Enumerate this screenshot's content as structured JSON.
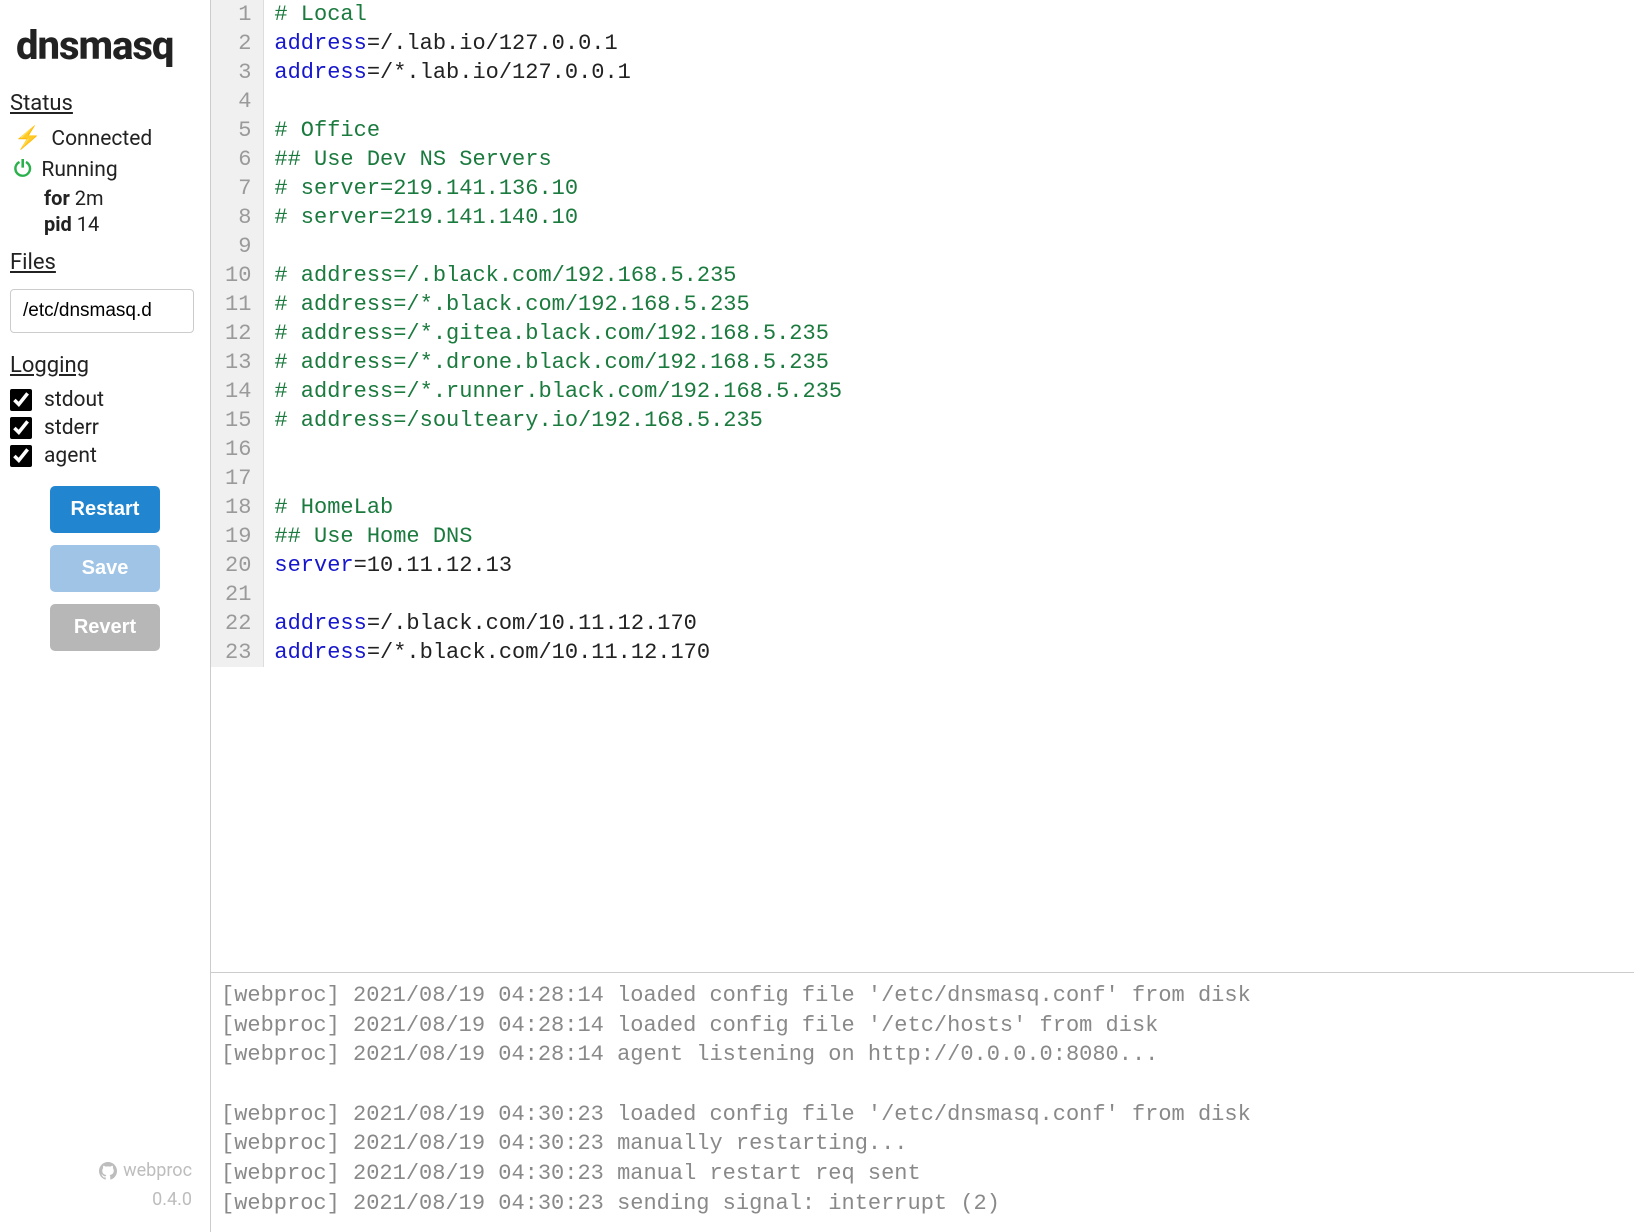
{
  "app": {
    "title": "dnsmasq"
  },
  "status": {
    "header": "Status",
    "connection": "Connected",
    "running": "Running",
    "uptime_label": "for",
    "uptime_value": "2m",
    "pid_label": "pid",
    "pid_value": "14"
  },
  "files": {
    "header": "Files",
    "selected": "/etc/dnsmasq.d"
  },
  "logging": {
    "header": "Logging",
    "items": [
      {
        "label": "stdout",
        "checked": true
      },
      {
        "label": "stderr",
        "checked": true
      },
      {
        "label": "agent",
        "checked": true
      }
    ]
  },
  "buttons": {
    "restart": "Restart",
    "save": "Save",
    "revert": "Revert"
  },
  "footer": {
    "project": "webproc",
    "version": "0.4.0"
  },
  "editor": {
    "lines": [
      {
        "n": 1,
        "type": "comment",
        "text": "# Local"
      },
      {
        "n": 2,
        "type": "kv",
        "key": "address",
        "val": "/.lab.io/127.0.0.1"
      },
      {
        "n": 3,
        "type": "kv",
        "key": "address",
        "val": "/*.lab.io/127.0.0.1"
      },
      {
        "n": 4,
        "type": "blank",
        "text": ""
      },
      {
        "n": 5,
        "type": "comment",
        "text": "# Office"
      },
      {
        "n": 6,
        "type": "comment",
        "text": "## Use Dev NS Servers"
      },
      {
        "n": 7,
        "type": "comment",
        "text": "# server=219.141.136.10"
      },
      {
        "n": 8,
        "type": "comment",
        "text": "# server=219.141.140.10"
      },
      {
        "n": 9,
        "type": "blank",
        "text": ""
      },
      {
        "n": 10,
        "type": "comment",
        "text": "# address=/.black.com/192.168.5.235"
      },
      {
        "n": 11,
        "type": "comment",
        "text": "# address=/*.black.com/192.168.5.235"
      },
      {
        "n": 12,
        "type": "comment",
        "text": "# address=/*.gitea.black.com/192.168.5.235"
      },
      {
        "n": 13,
        "type": "comment",
        "text": "# address=/*.drone.black.com/192.168.5.235"
      },
      {
        "n": 14,
        "type": "comment",
        "text": "# address=/*.runner.black.com/192.168.5.235"
      },
      {
        "n": 15,
        "type": "comment",
        "text": "# address=/soulteary.io/192.168.5.235"
      },
      {
        "n": 16,
        "type": "blank",
        "text": ""
      },
      {
        "n": 17,
        "type": "blank",
        "text": ""
      },
      {
        "n": 18,
        "type": "comment",
        "text": "# HomeLab"
      },
      {
        "n": 19,
        "type": "comment",
        "text": "## Use Home DNS"
      },
      {
        "n": 20,
        "type": "kv",
        "key": "server",
        "val": "10.11.12.13"
      },
      {
        "n": 21,
        "type": "blank",
        "text": ""
      },
      {
        "n": 22,
        "type": "kv",
        "key": "address",
        "val": "/.black.com/10.11.12.170"
      },
      {
        "n": 23,
        "type": "kv",
        "key": "address",
        "val": "/*.black.com/10.11.12.170"
      }
    ]
  },
  "log": {
    "lines": [
      "[webproc] 2021/08/19 04:28:14 loaded config file '/etc/dnsmasq.conf' from disk",
      "[webproc] 2021/08/19 04:28:14 loaded config file '/etc/hosts' from disk",
      "[webproc] 2021/08/19 04:28:14 agent listening on http://0.0.0.0:8080...",
      "",
      "[webproc] 2021/08/19 04:30:23 loaded config file '/etc/dnsmasq.conf' from disk",
      "[webproc] 2021/08/19 04:30:23 manually restarting...",
      "[webproc] 2021/08/19 04:30:23 manual restart req sent",
      "[webproc] 2021/08/19 04:30:23 sending signal: interrupt (2)"
    ]
  }
}
